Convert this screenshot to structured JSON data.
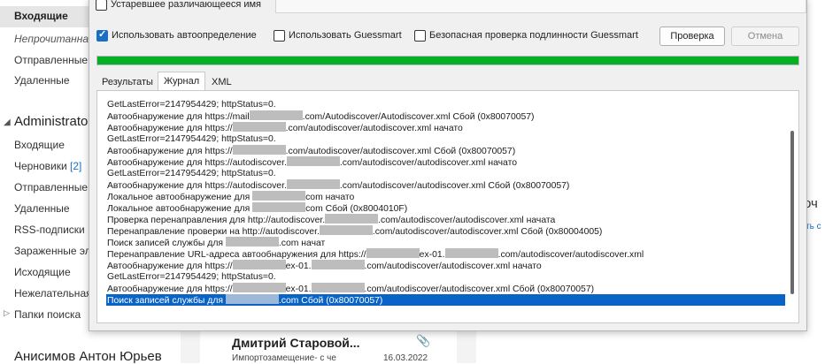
{
  "sidebar": {
    "folders_top": [
      {
        "label": "Входящие"
      },
      {
        "label": "Непрочитанная"
      },
      {
        "label": "Отправленные"
      },
      {
        "label": "Удаленные"
      }
    ],
    "account": "Administrato",
    "folders": [
      {
        "label": "Входящие"
      },
      {
        "label": "Черновики",
        "count": "[2]"
      },
      {
        "label": "Отправленные"
      },
      {
        "label": "Удаленные"
      },
      {
        "label": "RSS-подписки"
      },
      {
        "label": "Зараженные эл"
      },
      {
        "label": "Исходящие"
      },
      {
        "label": "Нежелательная"
      },
      {
        "label": "Папки поиска"
      }
    ],
    "bottom_account": "Анисимов Антон Юрьев"
  },
  "mail_item": {
    "sender": "Дмитрий Старовой...",
    "subject": "Импортозамещение- с че",
    "date": "16.03.2022"
  },
  "right_pane": {
    "text1": "оч",
    "link": "ть с"
  },
  "dialog": {
    "option_outdated": "Устаревшее различающееся имя",
    "option_autodetect": "Использовать автоопределение",
    "option_guessmart": "Использовать Guessmart",
    "option_secure": "Безопасная проверка подлинности Guessmart",
    "btn_check": "Проверка",
    "btn_cancel": "Отмена",
    "progress": 1.0,
    "progress_color": "#06b025",
    "selection_color": "#0a64c8",
    "tabs": [
      {
        "label": "Результаты"
      },
      {
        "label": "Журнал",
        "active": true
      },
      {
        "label": "XML"
      }
    ],
    "log": [
      [
        "GetLastError=2147954429; httpStatus=0.",
        "",
        ""
      ],
      [
        "Автообнаружение для https://mail",
        "R",
        ".com/Autodiscover/Autodiscover.xml Сбой (0x80070057)"
      ],
      [
        "Автообнаружение для https://",
        "R",
        ".com/autodiscover/autodiscover.xml начато"
      ],
      [
        "GetLastError=2147954429; httpStatus=0.",
        "",
        ""
      ],
      [
        "Автообнаружение для https://",
        "R",
        ".com/autodiscover/autodiscover.xml Сбой (0x80070057)"
      ],
      [
        "Автообнаружение для https://autodiscover.",
        "R",
        ".com/autodiscover/autodiscover.xml начато"
      ],
      [
        "GetLastError=2147954429; httpStatus=0.",
        "",
        ""
      ],
      [
        "Автообнаружение для https://autodiscover.",
        "R",
        ".com/autodiscover/autodiscover.xml Сбой (0x80070057)"
      ],
      [
        "Локальное автообнаружение для ",
        "R",
        "com начато"
      ],
      [
        "Локальное автообнаружение для ",
        "R",
        "com Сбой (0x8004010F)"
      ],
      [
        "Проверка перенаправления для http://autodiscover.",
        "R",
        ".com/autodiscover/autodiscover.xml начата"
      ],
      [
        "Перенаправление проверки на http://autodiscover.",
        "R",
        ".com/autodiscover/autodiscover.xml Сбой (0x80004005)"
      ],
      [
        "Поиск записей службы для ",
        "R",
        ".com начат"
      ],
      [
        "Перенаправление URL-адреса автообнаружения для https://",
        "R",
        "ex-01.",
        "R",
        ".com/autodiscover/autodiscover.xml"
      ],
      [
        "Автообнаружение для https://",
        "R",
        "ex-01.",
        "R",
        ".com/autodiscover/autodiscover.xml начато"
      ],
      [
        "GetLastError=2147954429; httpStatus=0.",
        "",
        ""
      ],
      [
        "Автообнаружение для https://",
        "R",
        "ex-01.",
        "R",
        ".com/autodiscover/autodiscover.xml Сбой (0x80070057)"
      ],
      [
        "Поиск записей службы для ",
        "R",
        ".com Сбой (0x80070057)"
      ]
    ],
    "selected_index": 17
  }
}
